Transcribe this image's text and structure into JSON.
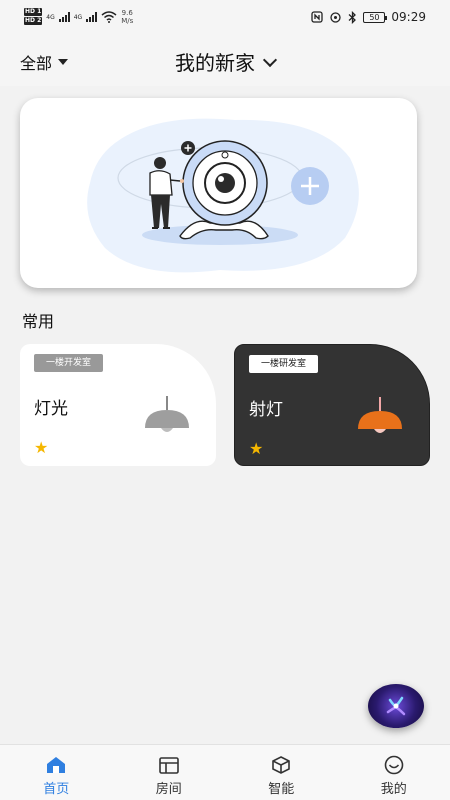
{
  "status_bar": {
    "hd1": "HD 1",
    "hd2": "HD 2",
    "net1": "4G",
    "net2": "4G",
    "speed_value": "9.6",
    "speed_unit": "M/s",
    "battery": "50",
    "time": "09:29"
  },
  "header": {
    "filter_label": "全部",
    "home_name": "我的新家"
  },
  "banner": {
    "illustration": "person-with-camera-illustration"
  },
  "section": {
    "title": "常用"
  },
  "devices": [
    {
      "room": "一楼开发室",
      "name": "灯光",
      "icon": "pendant-lamp-icon",
      "lamp_color": "#9e9e9e",
      "favorite": true,
      "theme": "light"
    },
    {
      "room": "一楼研发室",
      "name": "射灯",
      "icon": "pendant-lamp-icon",
      "lamp_color": "#e8711a",
      "favorite": true,
      "theme": "dark"
    }
  ],
  "assistant": {
    "icon": "voice-assistant-icon"
  },
  "tabbar": {
    "tabs": [
      {
        "label": "首页",
        "icon": "home-icon",
        "active": true
      },
      {
        "label": "房间",
        "icon": "room-icon",
        "active": false
      },
      {
        "label": "智能",
        "icon": "cube-icon",
        "active": false
      },
      {
        "label": "我的",
        "icon": "smile-icon",
        "active": false
      }
    ]
  },
  "colors": {
    "accent": "#2f7fe0",
    "star": "#f5b700",
    "dark_card": "#333333"
  }
}
